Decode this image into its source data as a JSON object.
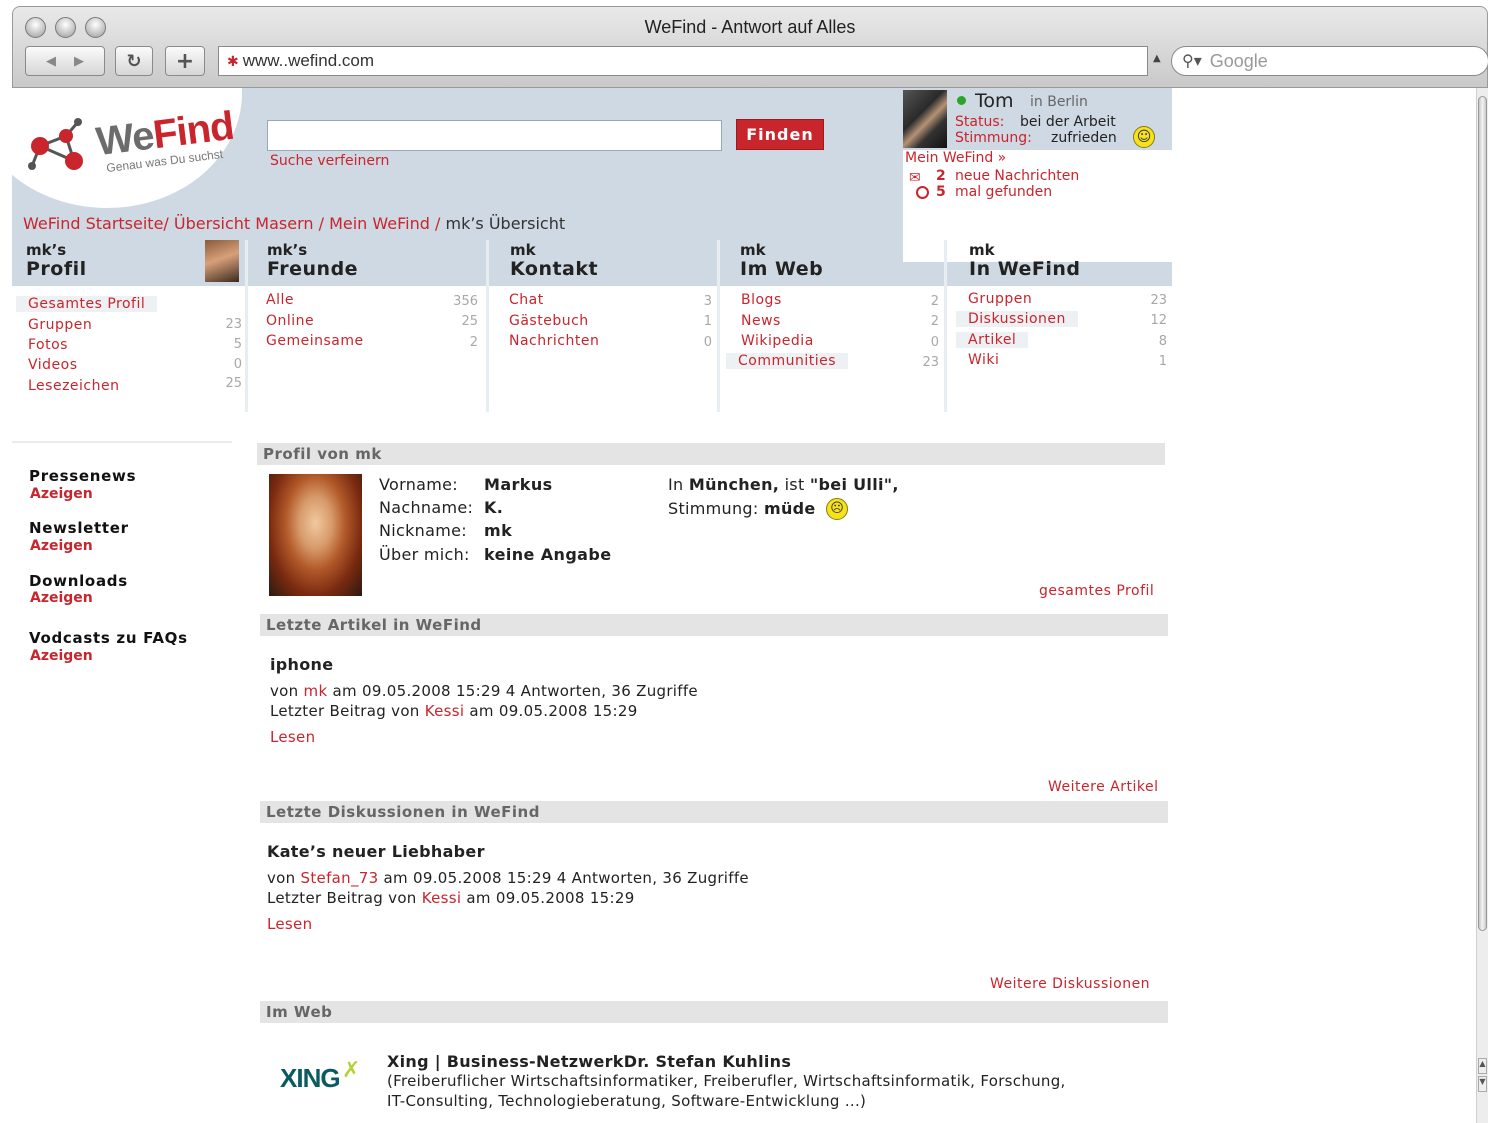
{
  "browser": {
    "title": "WeFind - Antwort auf Alles",
    "url": "www..wefind.com",
    "search_placeholder": "Google",
    "back_icon": "◀",
    "forward_icon": "▶",
    "reload_icon": "↻",
    "add_icon": "+"
  },
  "logo": {
    "we": "We",
    "find": "Find",
    "tagline": "Genau was Du suchst"
  },
  "search": {
    "value": "",
    "button": "Finden",
    "refine": "Suche verfeinern"
  },
  "user": {
    "name": "Tom",
    "city": "in Berlin",
    "status_label": "Status:",
    "status_value": "bei der Arbeit",
    "mood_label": "Stimmung:",
    "mood_value": "zufrieden",
    "mein_wefind": "Mein WeFind »",
    "messages_count": "2",
    "messages_text": "neue Nachrichten",
    "found_count": "5",
    "found_text": "mal gefunden"
  },
  "breadcrumb": {
    "items": [
      "WeFind Startseite/",
      "Übersicht Masern /",
      "Mein WeFind /"
    ],
    "current": "mk’s Übersicht"
  },
  "tabs": [
    {
      "small": "mk’s",
      "big": "Profil"
    },
    {
      "small": "mk’s",
      "big": "Freunde"
    },
    {
      "small": "mk",
      "big": "Kontakt"
    },
    {
      "small": "mk",
      "big": "Im Web"
    },
    {
      "small": "mk",
      "big": "In WeFind"
    }
  ],
  "menus": {
    "profil": [
      {
        "label": "Gesamtes Profil",
        "count": ""
      },
      {
        "label": "Gruppen",
        "count": "23"
      },
      {
        "label": "Fotos",
        "count": "5"
      },
      {
        "label": "Videos",
        "count": "0"
      },
      {
        "label": "Lesezeichen",
        "count": "25"
      }
    ],
    "freunde": [
      {
        "label": "Alle",
        "count": "356"
      },
      {
        "label": "Online",
        "count": "25"
      },
      {
        "label": "Gemeinsame",
        "count": "2"
      }
    ],
    "kontakt": [
      {
        "label": "Chat",
        "count": "3"
      },
      {
        "label": "Gästebuch",
        "count": "1"
      },
      {
        "label": "Nachrichten",
        "count": "0"
      }
    ],
    "web": [
      {
        "label": "Blogs",
        "count": "2"
      },
      {
        "label": "News",
        "count": "2"
      },
      {
        "label": "Wikipedia",
        "count": "0"
      },
      {
        "label": "Communities",
        "count": "23"
      }
    ],
    "wefind": [
      {
        "label": "Gruppen",
        "count": "23"
      },
      {
        "label": "Diskussionen",
        "count": "12"
      },
      {
        "label": "Artikel",
        "count": "8"
      },
      {
        "label": "Wiki",
        "count": "1"
      }
    ]
  },
  "sidebar": [
    {
      "title": "Pressenews",
      "link": "Azeigen"
    },
    {
      "title": "Newsletter",
      "link": "Azeigen"
    },
    {
      "title": "Downloads",
      "link": "Azeigen"
    },
    {
      "title": "Vodcasts zu FAQs",
      "link": "Azeigen"
    }
  ],
  "profile": {
    "section_title": "Profil von mk",
    "first_name_label": "Vorname:",
    "first_name": "Markus",
    "last_name_label": "Nachname:",
    "last_name": "K.",
    "nickname_label": "Nickname:",
    "nickname": "mk",
    "about_label": "Über mich:",
    "about": "keine Angabe",
    "location_prefix": "In",
    "location_city": "München,",
    "location_mid": "ist",
    "location_place": "\"bei Ulli\",",
    "mood_label": "Stimmung:",
    "mood_value": "müde",
    "full_profile_link": "gesamtes Profil"
  },
  "articles": {
    "section_title": "Letzte Artikel in WeFind",
    "title": "iphone",
    "by": "von",
    "author": "mk",
    "meta": "am 09.05.2008 15:29  4 Antworten, 36 Zugriffe",
    "last_prefix": "Letzter Beitrag von",
    "last_author": "Kessi",
    "last_date": "am 09.05.2008 15:29",
    "read": "Lesen",
    "more": "Weitere Artikel"
  },
  "discussions": {
    "section_title": "Letzte Diskussionen in WeFind",
    "title": "Kate’s neuer Liebhaber",
    "by": "von",
    "author": "Stefan_73",
    "meta": "am 09.05.2008 15:29 4 Antworten, 36 Zugriffe",
    "last_prefix": "Letzter Beitrag von",
    "last_author": "Kessi",
    "last_date": "am 09.05.2008 15:29",
    "read": "Lesen",
    "more": "Weitere Diskussionen"
  },
  "web": {
    "section_title": "Im Web",
    "logo_text": "XING",
    "title": "Xing | Business-NetzwerkDr. Stefan Kuhlins",
    "desc1": "(Freiberuflicher Wirtschaftsinformatiker, Freiberufler, Wirtschaftsinformatik, Forschung,",
    "desc2": "IT-Consulting, Technologieberatung, Software-Entwicklung ...)"
  },
  "colors": {
    "accent": "#c8252c",
    "header_band": "#cfd9e3",
    "section_bar": "#e4e4e4"
  }
}
